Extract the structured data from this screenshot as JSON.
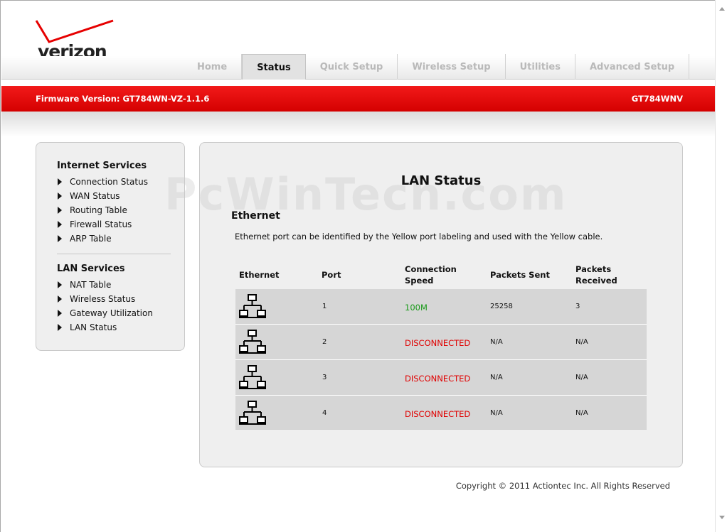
{
  "brand": {
    "logo_text": "verizon",
    "accent_color": "#e60000"
  },
  "tabs": [
    {
      "label": "Home"
    },
    {
      "label": "Status"
    },
    {
      "label": "Quick Setup"
    },
    {
      "label": "Wireless Setup"
    },
    {
      "label": "Utilities"
    },
    {
      "label": "Advanced Setup"
    }
  ],
  "firmware": {
    "label": "Firmware Version: GT784WN-VZ-1.1.6",
    "model": "GT784WNV"
  },
  "sidebar": {
    "internet_heading": "Internet Services",
    "internet_items": [
      {
        "label": "Connection Status"
      },
      {
        "label": "WAN Status"
      },
      {
        "label": "Routing Table"
      },
      {
        "label": "Firewall Status"
      },
      {
        "label": "ARP Table"
      }
    ],
    "lan_heading": "LAN Services",
    "lan_items": [
      {
        "label": "NAT Table"
      },
      {
        "label": "Wireless Status"
      },
      {
        "label": "Gateway Utilization"
      },
      {
        "label": "LAN Status"
      }
    ]
  },
  "watermark": "PcWinTech.com",
  "main": {
    "title": "LAN Status",
    "section": "Ethernet",
    "description": "Ethernet port can be identified by the Yellow port labeling and used with the Yellow cable.",
    "headers": {
      "ethernet": "Ethernet",
      "port": "Port",
      "speed_1": "Connection",
      "speed_2": "Speed",
      "sent": "Packets Sent",
      "recv_1": "Packets",
      "recv_2": "Received"
    },
    "rows": [
      {
        "port": "1",
        "speed": "100M",
        "sent": "25258",
        "received": "3"
      },
      {
        "port": "2",
        "speed": "DISCONNECTED",
        "sent": "N/A",
        "received": "N/A"
      },
      {
        "port": "3",
        "speed": "DISCONNECTED",
        "sent": "N/A",
        "received": "N/A"
      },
      {
        "port": "4",
        "speed": "DISCONNECTED",
        "sent": "N/A",
        "received": "N/A"
      }
    ],
    "icon": "network-icon",
    "connected_color": "#1a9a1a",
    "disconnected_color": "#e00000"
  },
  "footer": "Copyright © 2011 Actiontec Inc. All Rights Reserved"
}
